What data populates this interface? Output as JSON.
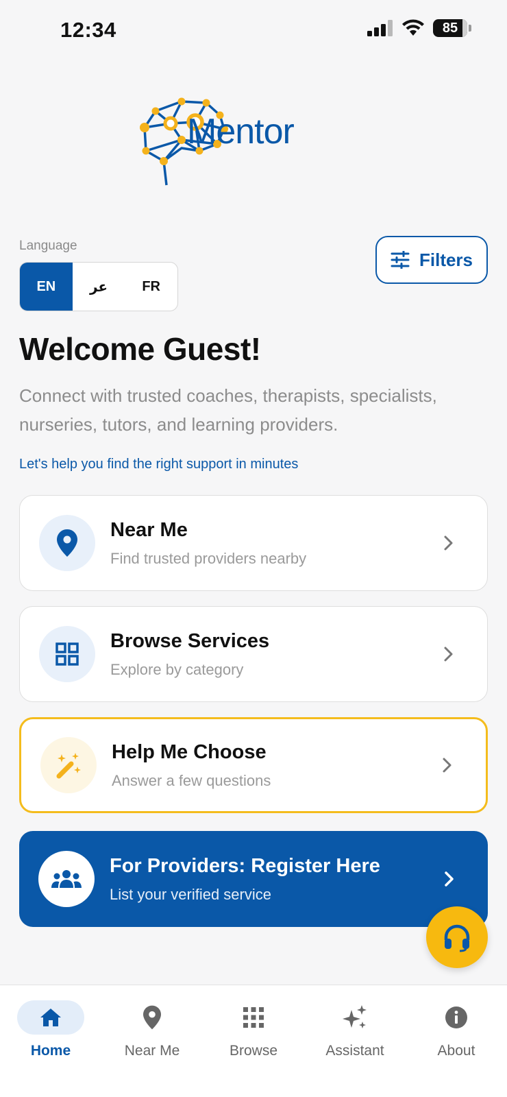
{
  "status": {
    "time": "12:34",
    "battery": "85"
  },
  "brand": {
    "name": "Mentor",
    "primary_color": "#0a58a8",
    "accent_color": "#f4bc1c"
  },
  "language": {
    "label": "Language",
    "options": [
      "EN",
      "عر",
      "FR"
    ],
    "selected": "EN"
  },
  "filters": {
    "label": "Filters",
    "icon": "sliders-icon"
  },
  "welcome": {
    "title": "Welcome Guest!",
    "description": "Connect with trusted coaches, therapists, specialists, nurseries, tutors, and learning providers.",
    "helper": "Let's help you find the right support in minutes"
  },
  "cards": [
    {
      "title": "Near Me",
      "subtitle": "Find trusted providers nearby",
      "icon": "location-pin-icon"
    },
    {
      "title": "Browse Services",
      "subtitle": "Explore by category",
      "icon": "grid-icon"
    },
    {
      "title": "Help Me Choose",
      "subtitle": "Answer a few questions",
      "icon": "magic-wand-icon"
    },
    {
      "title": "For Providers: Register Here",
      "subtitle": "List your verified service",
      "icon": "group-icon"
    }
  ],
  "support_fab": {
    "icon": "headset-icon"
  },
  "nav": [
    {
      "label": "Home",
      "icon": "home-icon",
      "active": true
    },
    {
      "label": "Near Me",
      "icon": "location-pin-icon",
      "active": false
    },
    {
      "label": "Browse",
      "icon": "apps-grid-icon",
      "active": false
    },
    {
      "label": "Assistant",
      "icon": "sparkle-icon",
      "active": false
    },
    {
      "label": "About",
      "icon": "info-icon",
      "active": false
    }
  ]
}
